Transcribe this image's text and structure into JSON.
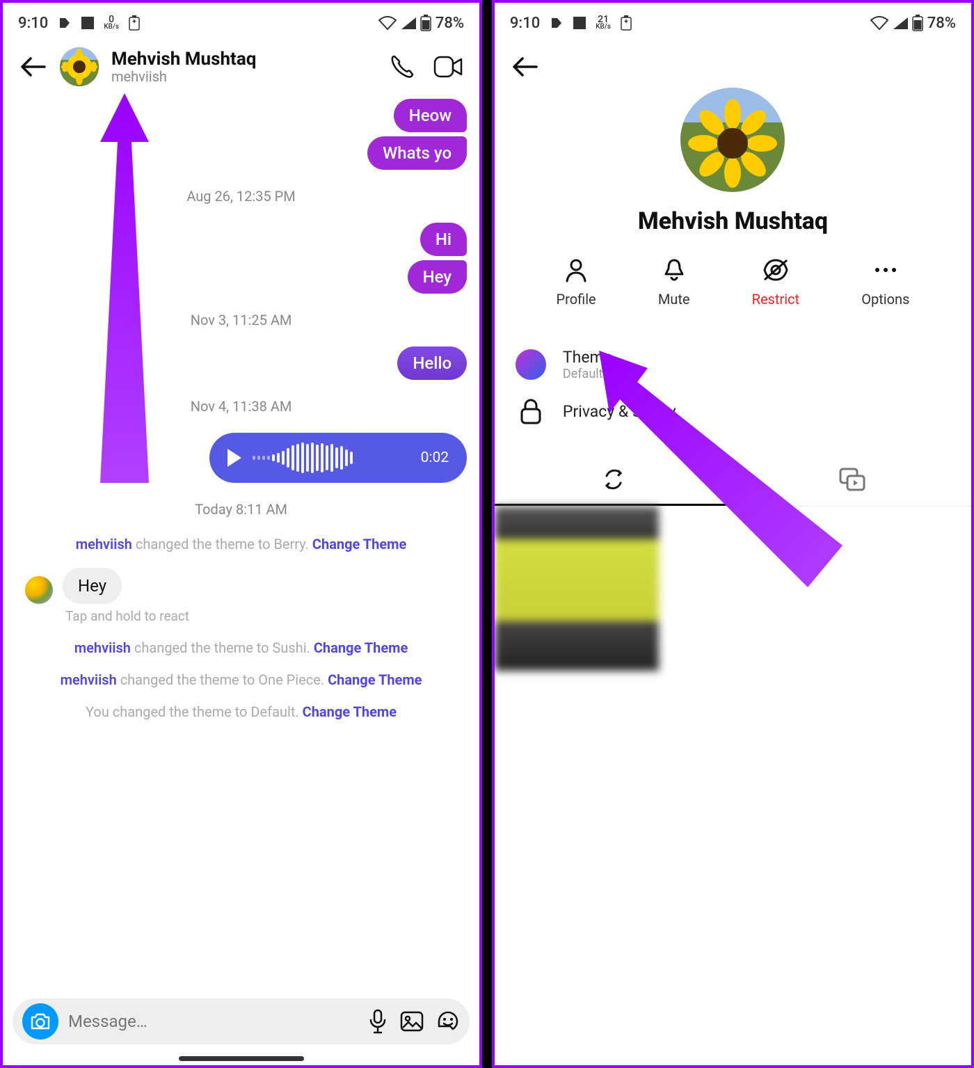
{
  "status": {
    "time": "9:10",
    "kbs1": "0",
    "kbs2": "21",
    "kbs_label": "KB/s",
    "battery": "78%"
  },
  "chat": {
    "contact_name": "Mehvish Mushtaq",
    "contact_username": "mehviish",
    "messages": {
      "m1": "Heow",
      "m2": "Whats yo",
      "ts1": "Aug 26, 12:35 PM",
      "m3": "Hi",
      "m4": "Hey",
      "ts2": "Nov 3, 11:25 AM",
      "m5": "Hello",
      "ts3": "Nov 4, 11:38 AM",
      "voice_duration": "0:02",
      "ts4": "Today 8:11 AM",
      "m6": "Hey"
    },
    "sys": {
      "who": "mehviish",
      "s1_mid": " changed the theme to Berry. ",
      "s2_mid": " changed the theme to Sushi. ",
      "s3_mid": " changed the theme to One Piece. ",
      "s4_full": "You changed the theme to Default. ",
      "action": "Change Theme"
    },
    "hint": "Tap and hold to react",
    "composer_placeholder": "Message…"
  },
  "profile": {
    "name": "Mehvish Mushtaq",
    "actions": {
      "profile": "Profile",
      "mute": "Mute",
      "restrict": "Restrict",
      "options": "Options"
    },
    "settings": {
      "theme_title": "Theme",
      "theme_sub": "Default",
      "privacy_title": "Privacy & safety"
    }
  }
}
